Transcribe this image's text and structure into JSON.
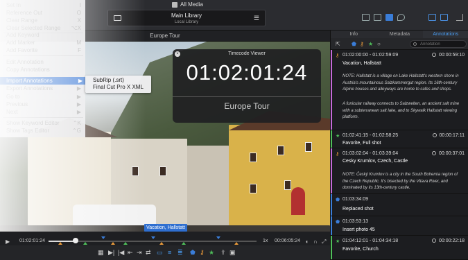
{
  "header": {
    "breadcrumb": "All Media",
    "library_title": "Main Library",
    "library_sub": "Local Library"
  },
  "viewer": {
    "title": "Europe Tour",
    "clip_label": "Vacation, Hallstatt"
  },
  "timecode_viewer": {
    "title": "Timecode Viewer",
    "timecode": "01:02:01:24",
    "name": "Europe Tour"
  },
  "context_menu": {
    "items": [
      {
        "label": "Set In",
        "key": "I"
      },
      {
        "label": "Reference Out",
        "key": "O"
      },
      {
        "label": "Clear Range",
        "key": "X"
      },
      {
        "label": "Clear Selected Range",
        "key": "⌥X"
      },
      {
        "label": "Add Keyword",
        "key": ""
      },
      {
        "label": "Add Marker",
        "key": "M"
      },
      {
        "label": "Add Favorite",
        "key": "F"
      },
      {
        "label": "Edit Annotation",
        "key": ""
      },
      {
        "label": "Copy Annotations",
        "key": ""
      },
      {
        "label": "Import Annotations",
        "key": "▶"
      },
      {
        "label": "Export Annotations",
        "key": "▶"
      },
      {
        "label": "Go to",
        "key": "▶"
      },
      {
        "label": "Previous",
        "key": "▶"
      },
      {
        "label": "Next",
        "key": "▶"
      },
      {
        "label": "Show Keyword Editor",
        "key": "⌃K"
      },
      {
        "label": "Show Tags Editor",
        "key": "⌃G"
      }
    ],
    "submenu": [
      "SubRip (.srt)",
      "Final Cut Pro X XML"
    ]
  },
  "timeline": {
    "current": "01:02:01:24",
    "speed": "1x",
    "duration": "00:06:05:24"
  },
  "panel": {
    "tabs": [
      "Info",
      "Metadata",
      "Annotations"
    ],
    "active_tab": "Annotations",
    "search_placeholder": "Annotation"
  },
  "annotations": [
    {
      "range": "01:02:00:00 - 01:02:59:09",
      "duration": "00:00:59:10",
      "title": "Vacation, Hallstatt",
      "color": "#c46ad8",
      "icon": "key",
      "notes": [
        "NOTE: Hallstatt is a village on Lake Hallstatt's western shore in Austria's mountainous Salzkammergut region. Its 16th-century Alpine houses and alleyways are home to cafes and shops.",
        "A funicular railway connects to Salzwelten, an ancient salt mine with a subterranean salt lake, and to Skywalk Hallstatt viewing platform."
      ]
    },
    {
      "range": "01:02:41:15 - 01:02:58:25",
      "duration": "00:00:17:11",
      "title": "Favorite,  Full shot",
      "color": "#4fbf5a",
      "icon": "star",
      "notes": []
    },
    {
      "range": "01:03:02:04 - 01:03:39:04",
      "duration": "00:00:37:01",
      "title": "Cesky Krumlov, Czech, Castle",
      "color": "#c46ad8",
      "icon": "key",
      "notes": [
        "NOTE: Český Krumlov is a city in the South Bohemia region of the Czech Republic. It's bisected by the Vltava River, and dominated by its 13th-century castle."
      ]
    },
    {
      "range": "01:03:34:09",
      "duration": "",
      "title": "Replaced shot",
      "color": "#3a7dd8",
      "icon": "marker",
      "notes": []
    },
    {
      "range": "01:03:53:13",
      "duration": "",
      "title": "Insert photo 45",
      "color": "#3a7dd8",
      "icon": "marker",
      "notes": []
    },
    {
      "range": "01:04:12:01 - 01:04:34:18",
      "duration": "00:00:22:18",
      "title": "Favorite,  Church",
      "color": "#4fbf5a",
      "icon": "star",
      "notes": []
    }
  ]
}
